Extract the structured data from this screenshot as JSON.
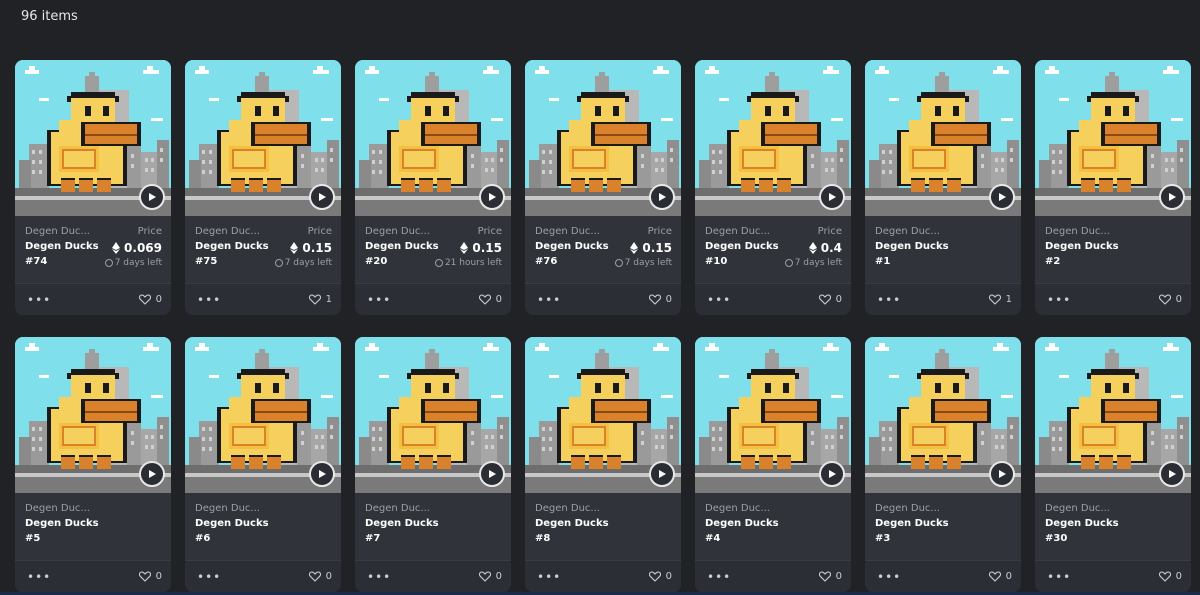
{
  "header": {
    "item_count": "96 items"
  },
  "labels": {
    "price": "Price"
  },
  "colors": {
    "background": "#202225",
    "card": "#303339",
    "sky": "#7fe0ec",
    "duck": "#f5d05c",
    "beak": "#d9822b"
  },
  "icons": {
    "menu": "more-dots-icon",
    "like": "heart-icon",
    "play": "play-icon",
    "currency": "eth-icon",
    "time": "clock-icon"
  },
  "cards": [
    {
      "collection": "Degen Duc...",
      "name": "Degen Ducks",
      "number": "#74",
      "price": "0.069",
      "time_left": "7 days left",
      "likes": "0"
    },
    {
      "collection": "Degen Duc...",
      "name": "Degen Ducks",
      "number": "#75",
      "price": "0.15",
      "time_left": "7 days left",
      "likes": "1"
    },
    {
      "collection": "Degen Duc...",
      "name": "Degen Ducks",
      "number": "#20",
      "price": "0.15",
      "time_left": "21 hours left",
      "likes": "0"
    },
    {
      "collection": "Degen Duc...",
      "name": "Degen Ducks",
      "number": "#76",
      "price": "0.15",
      "time_left": "7 days left",
      "likes": "0"
    },
    {
      "collection": "Degen Duc...",
      "name": "Degen Ducks",
      "number": "#10",
      "price": "0.4",
      "time_left": "7 days left",
      "likes": "0"
    },
    {
      "collection": "Degen Duc...",
      "name": "Degen Ducks",
      "number": "#1",
      "likes": "1"
    },
    {
      "collection": "Degen Duc...",
      "name": "Degen Ducks",
      "number": "#2",
      "likes": "0"
    },
    {
      "collection": "Degen Duc...",
      "name": "Degen Ducks",
      "number": "#5",
      "likes": "0"
    },
    {
      "collection": "Degen Duc...",
      "name": "Degen Ducks",
      "number": "#6",
      "likes": "0"
    },
    {
      "collection": "Degen Duc...",
      "name": "Degen Ducks",
      "number": "#7",
      "likes": "0"
    },
    {
      "collection": "Degen Duc...",
      "name": "Degen Ducks",
      "number": "#8",
      "likes": "0"
    },
    {
      "collection": "Degen Duc...",
      "name": "Degen Ducks",
      "number": "#4",
      "likes": "0"
    },
    {
      "collection": "Degen Duc...",
      "name": "Degen Ducks",
      "number": "#3",
      "likes": "0"
    },
    {
      "collection": "Degen Duc...",
      "name": "Degen Ducks",
      "number": "#30",
      "likes": "0"
    }
  ]
}
